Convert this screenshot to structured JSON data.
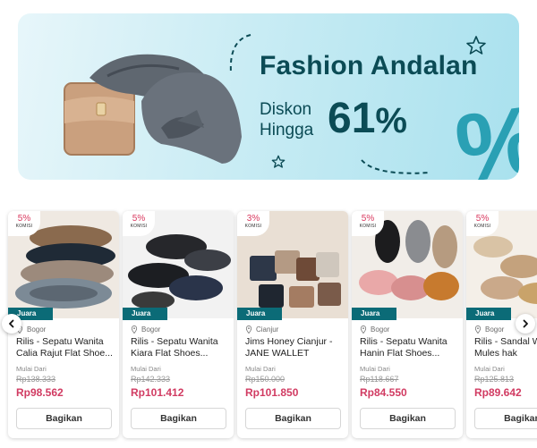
{
  "banner": {
    "title": "Fashion Andalan",
    "sub_line1": "Diskon",
    "sub_line2": "Hingga",
    "discount": "61",
    "discount_unit": "%",
    "big_symbol": "%"
  },
  "commission_label": "KOMISI",
  "badge_label": "Juara",
  "start_label": "Mulai Dari",
  "share_label": "Bagikan",
  "products": [
    {
      "commission": "5%",
      "location": "Bogor",
      "name": "Rilis - Sepatu Wanita Calia Rajut Flat Shoe...",
      "old_price": "Rp138.333",
      "price": "Rp98.562"
    },
    {
      "commission": "5%",
      "location": "Bogor",
      "name": "Rilis - Sepatu Wanita Kiara Flat Shoes...",
      "old_price": "Rp142.333",
      "price": "Rp101.412"
    },
    {
      "commission": "3%",
      "location": "Cianjur",
      "name": "Jims Honey Cianjur - JANE WALLET",
      "old_price": "Rp150.000",
      "price": "Rp101.850"
    },
    {
      "commission": "5%",
      "location": "Bogor",
      "name": "Rilis - Sepatu Wanita Hanin Flat Shoes...",
      "old_price": "Rp118.667",
      "price": "Rp84.550"
    },
    {
      "commission": "5%",
      "location": "Bogor",
      "name": "Rilis - Sandal W Elsa Mules hak",
      "old_price": "Rp125.813",
      "price": "Rp89.642"
    }
  ],
  "colors": {
    "accent_price": "#d13b62",
    "badge": "#0b6b77",
    "banner_text": "#0b4b55"
  },
  "icons": {
    "prev": "chevron-left-icon",
    "next": "chevron-right-icon",
    "location": "location-pin-icon"
  }
}
